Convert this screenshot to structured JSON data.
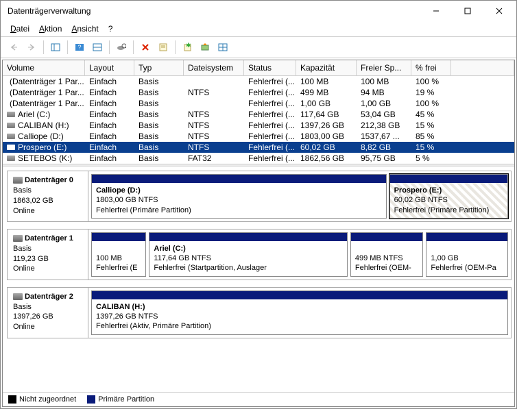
{
  "window": {
    "title": "Datenträgerverwaltung"
  },
  "menubar": {
    "items": [
      {
        "label": "Datei",
        "accel": 0
      },
      {
        "label": "Aktion",
        "accel": 0
      },
      {
        "label": "Ansicht",
        "accel": 0
      },
      {
        "label": "?",
        "accel": -1
      }
    ]
  },
  "columns": {
    "volume": "Volume",
    "layout": "Layout",
    "typ": "Typ",
    "dateisystem": "Dateisystem",
    "status": "Status",
    "kapazitaet": "Kapazität",
    "freier": "Freier Sp...",
    "pfrei": "% frei"
  },
  "volumes": [
    {
      "name": "(Datenträger 1 Par...",
      "layout": "Einfach",
      "typ": "Basis",
      "fs": "",
      "status": "Fehlerfrei (...",
      "cap": "100 MB",
      "free": "100 MB",
      "pct": "100 %",
      "selected": false
    },
    {
      "name": "(Datenträger 1 Par...",
      "layout": "Einfach",
      "typ": "Basis",
      "fs": "NTFS",
      "status": "Fehlerfrei (...",
      "cap": "499 MB",
      "free": "94 MB",
      "pct": "19 %",
      "selected": false
    },
    {
      "name": "(Datenträger 1 Par...",
      "layout": "Einfach",
      "typ": "Basis",
      "fs": "",
      "status": "Fehlerfrei (...",
      "cap": "1,00 GB",
      "free": "1,00 GB",
      "pct": "100 %",
      "selected": false
    },
    {
      "name": "Ariel (C:)",
      "layout": "Einfach",
      "typ": "Basis",
      "fs": "NTFS",
      "status": "Fehlerfrei (...",
      "cap": "117,64 GB",
      "free": "53,04 GB",
      "pct": "45 %",
      "selected": false
    },
    {
      "name": "CALIBAN (H:)",
      "layout": "Einfach",
      "typ": "Basis",
      "fs": "NTFS",
      "status": "Fehlerfrei (...",
      "cap": "1397,26 GB",
      "free": "212,38 GB",
      "pct": "15 %",
      "selected": false
    },
    {
      "name": "Calliope (D:)",
      "layout": "Einfach",
      "typ": "Basis",
      "fs": "NTFS",
      "status": "Fehlerfrei (...",
      "cap": "1803,00 GB",
      "free": "1537,67 ...",
      "pct": "85 %",
      "selected": false
    },
    {
      "name": "Prospero (E:)",
      "layout": "Einfach",
      "typ": "Basis",
      "fs": "NTFS",
      "status": "Fehlerfrei (...",
      "cap": "60,02 GB",
      "free": "8,82 GB",
      "pct": "15 %",
      "selected": true
    },
    {
      "name": "SETEBOS (K:)",
      "layout": "Einfach",
      "typ": "Basis",
      "fs": "FAT32",
      "status": "Fehlerfrei (...",
      "cap": "1862,56 GB",
      "free": "95,75 GB",
      "pct": "5 %",
      "selected": false
    }
  ],
  "disks": [
    {
      "name": "Datenträger 0",
      "typ": "Basis",
      "cap": "1863,02 GB",
      "state": "Online",
      "parts": [
        {
          "title": "Calliope  (D:)",
          "sub": "1803,00 GB NTFS",
          "info": "Fehlerfrei (Primäre Partition)",
          "flex": 30,
          "selected": false
        },
        {
          "title": "Prospero  (E:)",
          "sub": "60,02 GB NTFS",
          "info": "Fehlerfrei (Primäre Partition)",
          "flex": 12,
          "selected": true
        }
      ]
    },
    {
      "name": "Datenträger 1",
      "typ": "Basis",
      "cap": "119,23 GB",
      "state": "Online",
      "parts": [
        {
          "title": "",
          "sub": "100 MB",
          "info": "Fehlerfrei (E",
          "flex": 6,
          "selected": false
        },
        {
          "title": "Ariel  (C:)",
          "sub": "117,64 GB NTFS",
          "info": "Fehlerfrei (Startpartition, Auslager",
          "flex": 22,
          "selected": false
        },
        {
          "title": "",
          "sub": "499 MB NTFS",
          "info": "Fehlerfrei (OEM-",
          "flex": 8,
          "selected": false
        },
        {
          "title": "",
          "sub": "1,00 GB",
          "info": "Fehlerfrei (OEM-Pa",
          "flex": 9,
          "selected": false
        }
      ]
    },
    {
      "name": "Datenträger 2",
      "typ": "Basis",
      "cap": "1397,26 GB",
      "state": "Online",
      "parts": [
        {
          "title": "CALIBAN  (H:)",
          "sub": "1397,26 GB NTFS",
          "info": "Fehlerfrei (Aktiv, Primäre Partition)",
          "flex": 1,
          "selected": false
        }
      ]
    }
  ],
  "legend": {
    "unallocated": "Nicht zugeordnet",
    "primary": "Primäre Partition"
  }
}
